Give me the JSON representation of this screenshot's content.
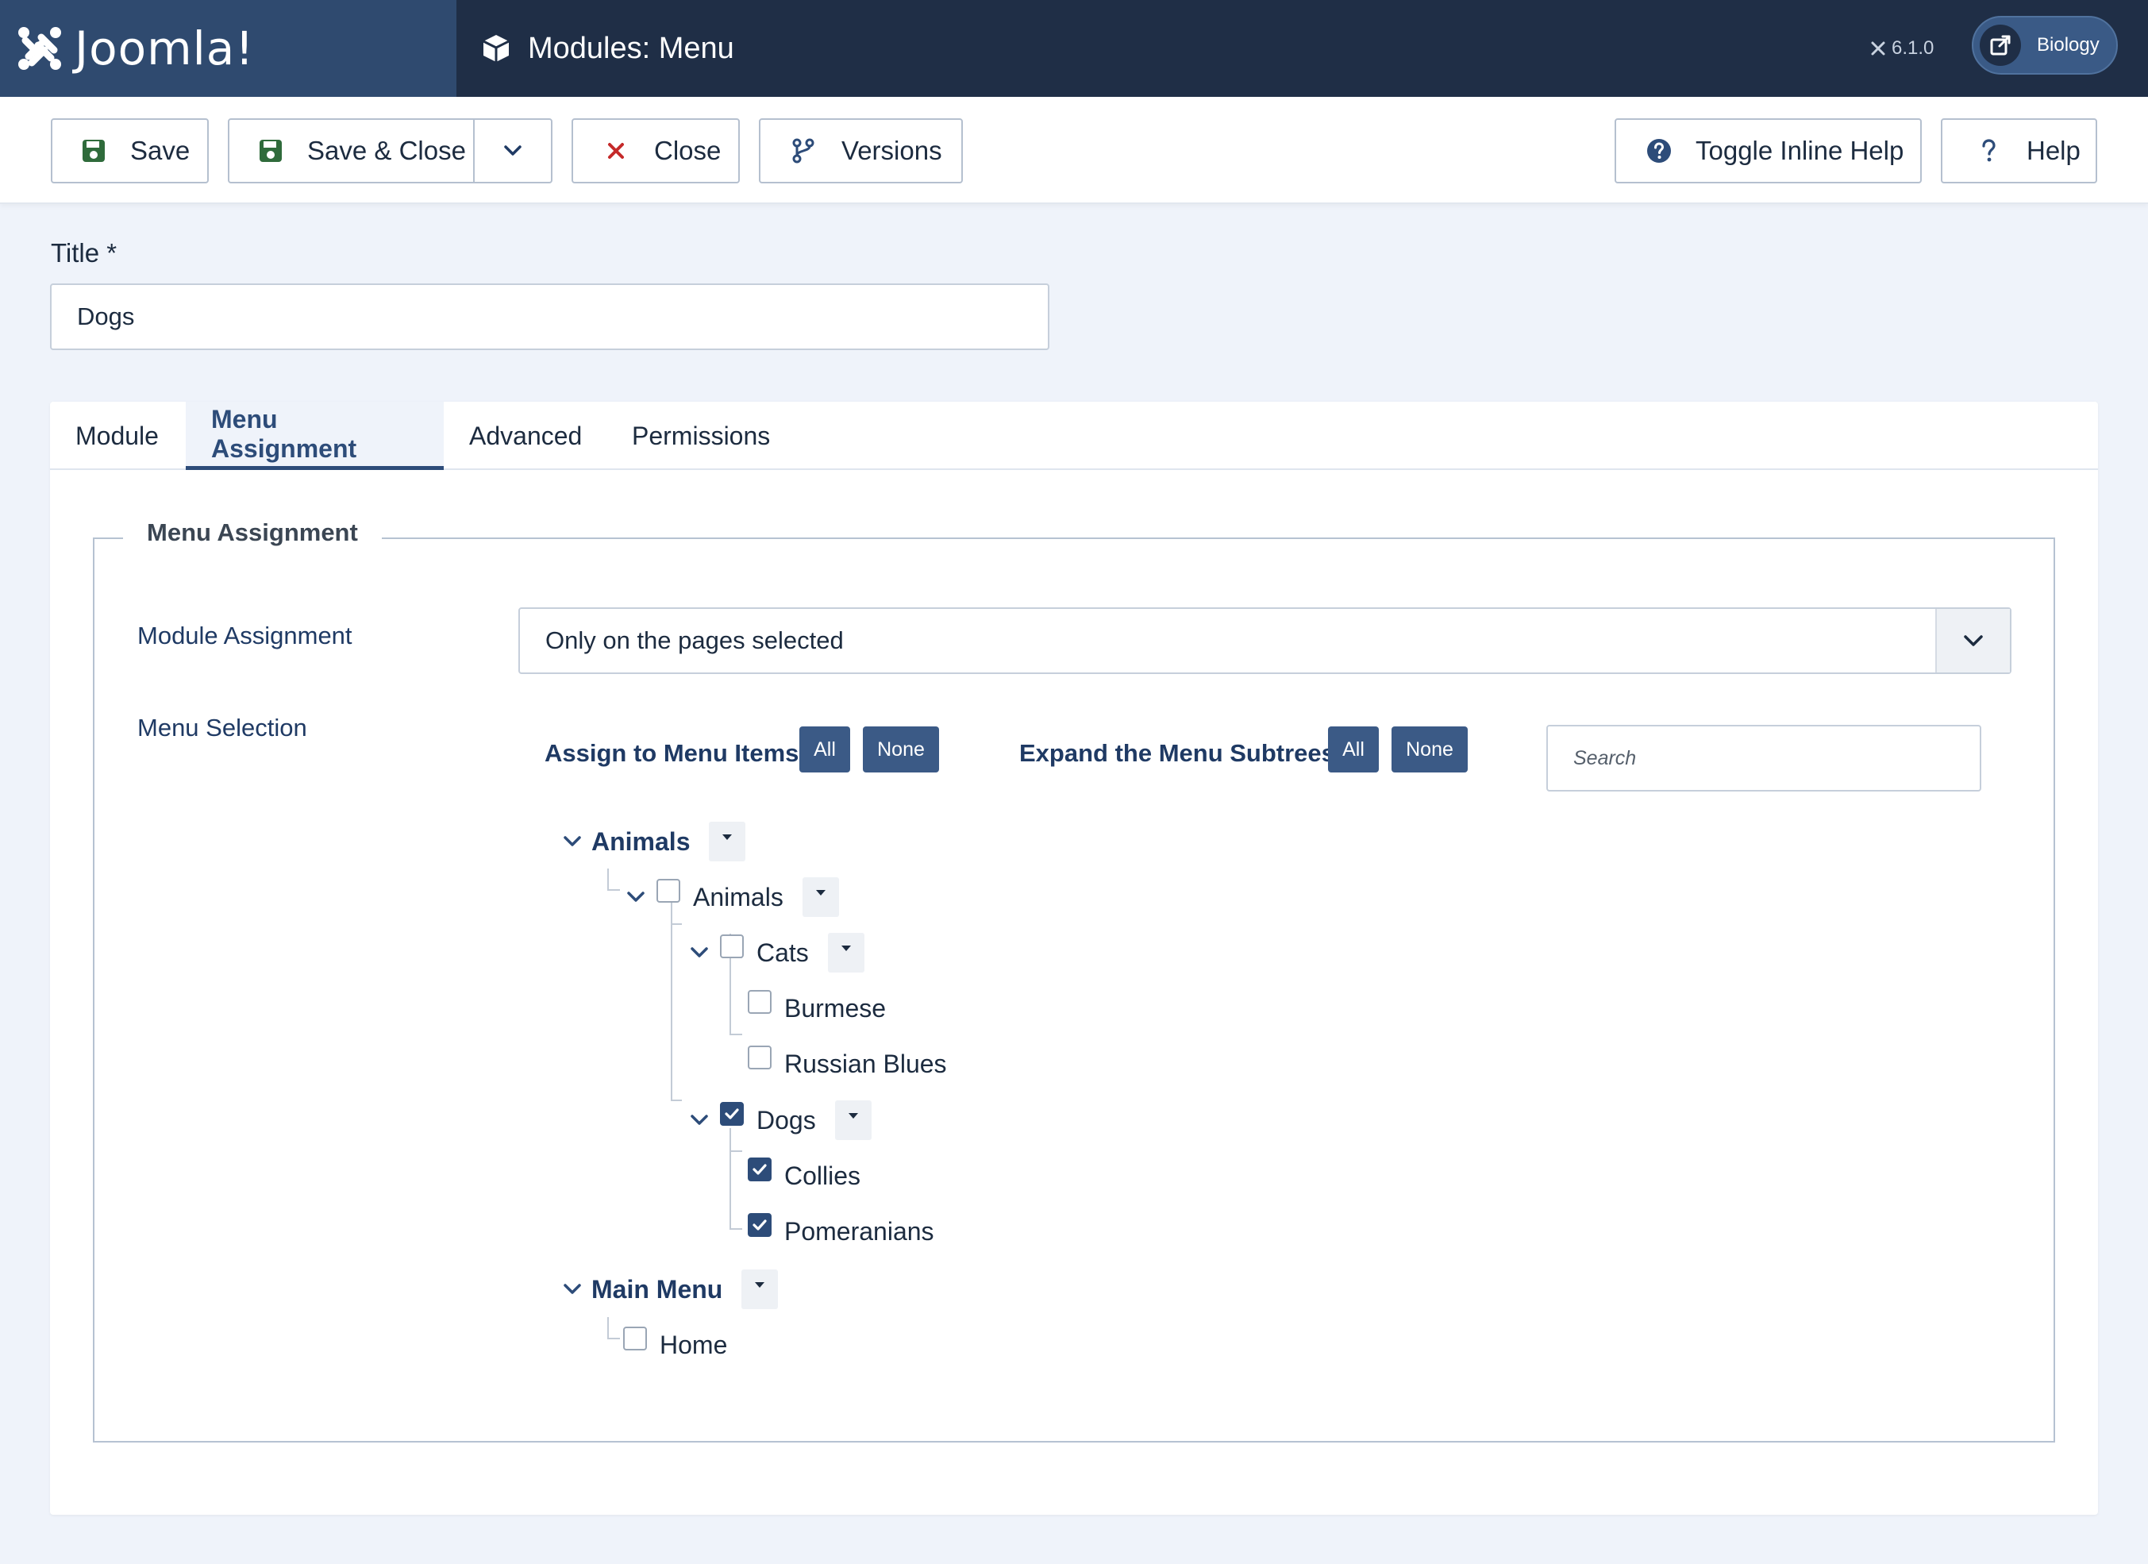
{
  "header": {
    "brand": "Joomla!",
    "page_title": "Modules: Menu",
    "version": "6.1.0",
    "site_name": "Biology"
  },
  "toolbar": {
    "save": "Save",
    "save_close": "Save & Close",
    "close": "Close",
    "versions": "Versions",
    "toggle_inline_help": "Toggle Inline Help",
    "help": "Help"
  },
  "form": {
    "title_label": "Title *",
    "title_value": "Dogs"
  },
  "tabs": [
    {
      "label": "Module"
    },
    {
      "label": "Menu Assignment",
      "active": true
    },
    {
      "label": "Advanced"
    },
    {
      "label": "Permissions"
    }
  ],
  "menu_assignment": {
    "legend": "Menu Assignment",
    "module_assignment_label": "Module Assignment",
    "module_assignment_value": "Only on the pages selected",
    "menu_selection_label": "Menu Selection",
    "assign_label": "Assign to Menu Items",
    "expand_label": "Expand the Menu Subtrees",
    "all": "All",
    "none": "None",
    "search_placeholder": "Search"
  },
  "tree": {
    "animals_menu": "Animals",
    "animals_item": "Animals",
    "cats": "Cats",
    "burmese": "Burmese",
    "russian_blues": "Russian Blues",
    "dogs": "Dogs",
    "collies": "Collies",
    "pomeranians": "Pomeranians",
    "main_menu": "Main Menu",
    "home": "Home"
  },
  "checked": {
    "animals_item": false,
    "cats": false,
    "burmese": false,
    "russian_blues": false,
    "dogs": true,
    "collies": true,
    "pomeranians": true,
    "home": false
  },
  "colors": {
    "header_bg": "#1f2e46",
    "brand_bg": "#2f4a6f",
    "accent": "#2d4c79",
    "button_blue": "#3b5a86",
    "close_red": "#c52a2a",
    "save_green": "#2f6b3b",
    "page_bg": "#eff3fa"
  }
}
